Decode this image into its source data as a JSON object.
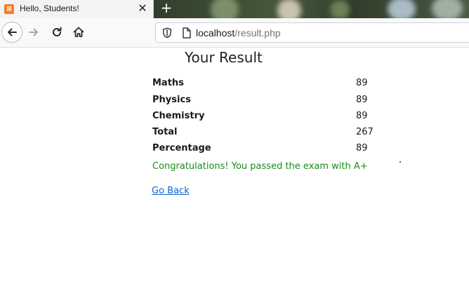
{
  "browser": {
    "tab": {
      "title": "Hello, Students!",
      "favicon": "xampp-icon",
      "favicon_glyph": "⊠",
      "close_glyph": "✕"
    },
    "new_tab_glyph": "+",
    "toolbar": {
      "back_icon": "back-arrow-icon",
      "forward_icon": "forward-arrow-icon",
      "reload_icon": "reload-icon",
      "home_icon": "home-icon"
    },
    "url": {
      "host": "localhost",
      "path": "/result.php"
    }
  },
  "page": {
    "title": "Your Result",
    "rows": [
      {
        "label": "Maths",
        "value": "89"
      },
      {
        "label": "Physics",
        "value": "89"
      },
      {
        "label": "Chemistry",
        "value": "89"
      },
      {
        "label": "Total",
        "value": "267"
      },
      {
        "label": "Percentage",
        "value": "89"
      }
    ],
    "message": "Congratulations! You passed the exam with A+",
    "link": "Go Back"
  },
  "colors": {
    "message": "#1a8a1a",
    "link": "#0b63ce",
    "favicon": "#fb7a24"
  }
}
